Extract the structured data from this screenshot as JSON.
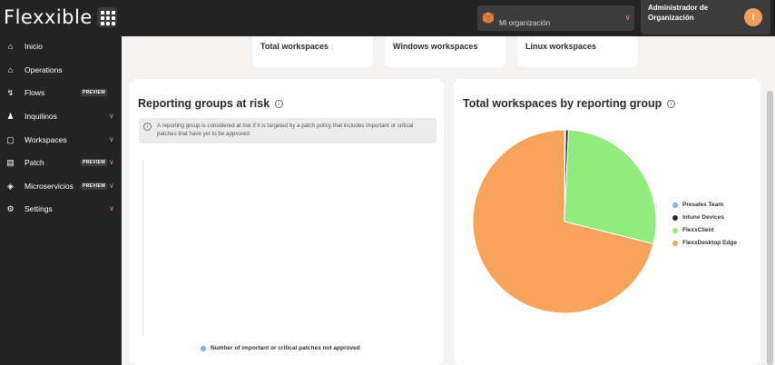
{
  "header": {
    "logo_text": "Flexxible",
    "org_label": "Mi organización",
    "user_name": "Administrador de Organización",
    "user_initial": "I"
  },
  "sidebar": {
    "items": [
      {
        "label": "Inicio",
        "icon": "home-icon"
      },
      {
        "label": "Operations",
        "icon": "home-icon"
      },
      {
        "label": "Flows",
        "icon": "flows-icon",
        "badge": "PREVIEW"
      },
      {
        "label": "Inquilinos",
        "icon": "tenants-icon",
        "chevron": true
      },
      {
        "label": "Workspaces",
        "icon": "workspaces-icon",
        "chevron": true
      },
      {
        "label": "Patch",
        "icon": "patch-icon",
        "badge": "PREVIEW",
        "chevron": true
      },
      {
        "label": "Microservicios",
        "icon": "cube-icon",
        "badge": "PREVIEW",
        "chevron": true
      },
      {
        "label": "Settings",
        "icon": "gear-icon",
        "chevron": true
      }
    ]
  },
  "stat_cards": [
    "Total workspaces",
    "Windows workspaces",
    "Linux workspaces"
  ],
  "left_panel": {
    "title": "Reporting groups at risk",
    "alert": "A reporting group is considered at risk if it is targeted by a patch policy that includes important or critical patches that have yet to be approved.",
    "legend": "Number of important or critical patches not approved",
    "legend_color": "#7cb5ec"
  },
  "right_panel": {
    "title": "Total workspaces by reporting group"
  },
  "chart_data": {
    "type": "pie",
    "title": "Total workspaces by reporting group",
    "categories": [
      "Presales Team",
      "Intune Devices",
      "FlexxClient",
      "FlexxDesktop Edge"
    ],
    "values": [
      0.2,
      0.5,
      28.2,
      71.1
    ],
    "colors": [
      "#7cb5ec",
      "#2b2b2b",
      "#90ed7d",
      "#f7a35c"
    ],
    "legend_position": "right"
  },
  "colors": {
    "accent": "#e08a4e",
    "dark": "#232323"
  }
}
